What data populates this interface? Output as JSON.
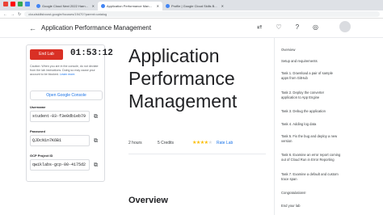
{
  "browser": {
    "tabs": [
      {
        "label": "Google Cloud Next 2022 Harn..."
      },
      {
        "label": "Application Performance Man..."
      },
      {
        "label": "Profile | Google Cloud Skills B..."
      }
    ],
    "url": "cloudskillsboost.google/focuses/19470?parent=catalog"
  },
  "appbar": {
    "title": "Application Performance Management"
  },
  "panel": {
    "end_lab_label": "End Lab",
    "timer": "01:53:12",
    "caution_text": "Caution: When you are in the console, do not deviate from the lab instructions. Doing so may cause your account to be blocked.",
    "learn_more": "Learn more.",
    "console_button": "Open Google Console",
    "username_label": "Username",
    "username": "student-03-f3e0db1eb79",
    "password_label": "Password",
    "password": "QJDcN1n7K6B1",
    "project_label": "GCP Project ID",
    "project_id": "qwiklabs-gcp-00-4175d2"
  },
  "main": {
    "title_line1": "Application",
    "title_line2": "Performance",
    "title_line3": "Management",
    "duration": "2 hours",
    "credits": "5 Credits",
    "rating_stars": 4,
    "rate_lab": "Rate Lab",
    "overview_heading": "Overview"
  },
  "toc": [
    "Overview",
    "Setup and requirements",
    "Task 1. Download a pair of sample apps from GitHub",
    "Task 2. Deploy the converter application to App Engine",
    "Task 3. Debug the application",
    "Task 4. Adding log data",
    "Task 5. Fix the bug and deploy a new version",
    "Task 6. Examine an error report coming out of Cloud Run in Error Reporting",
    "Task 7. Examine a default and custom trace span",
    "Congratulations!",
    "End your lab"
  ],
  "colors": {
    "end_lab": "#d93025",
    "link": "#1a73e8",
    "star": "#fbbc04"
  }
}
